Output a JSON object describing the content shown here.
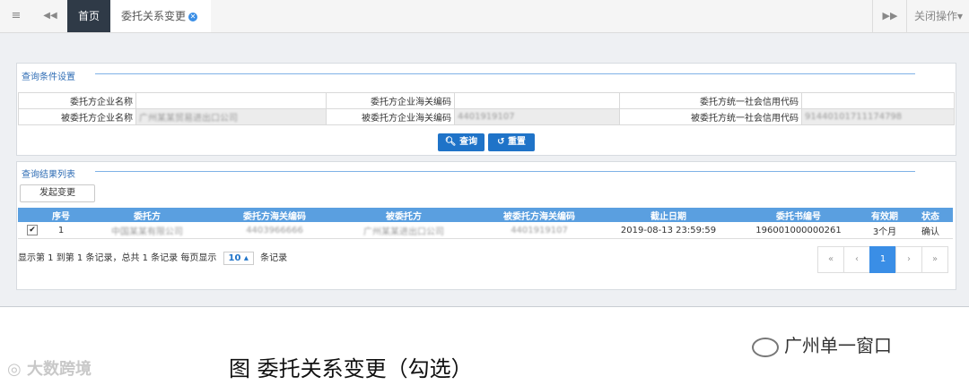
{
  "tabbar": {
    "menu_icon": "≡",
    "prev_icon": "◀◀",
    "home_tab": "首页",
    "active_tab": "委托关系变更",
    "close_glyph": "✕",
    "next_icon": "▶▶",
    "close_ops": "关闭操作▾"
  },
  "query": {
    "section_title": "查询条件设置",
    "rows": [
      [
        {
          "label": "委托方企业名称",
          "value": ""
        },
        {
          "label": "委托方企业海关编码",
          "value": ""
        },
        {
          "label": "委托方统一社会信用代码",
          "value": ""
        }
      ],
      [
        {
          "label": "被委托方企业名称",
          "value": "广州某某贸易进出口公司"
        },
        {
          "label": "被委托方企业海关编码",
          "value": "4401919107"
        },
        {
          "label": "被委托方统一社会信用代码",
          "value": "91440101711174798"
        }
      ]
    ],
    "search_label": "查询",
    "reset_label": "重置"
  },
  "results": {
    "section_title": "查询结果列表",
    "initiate_label": "发起变更",
    "columns": [
      "",
      "序号",
      "委托方",
      "委托方海关编码",
      "被委托方",
      "被委托方海关编码",
      "截止日期",
      "委托书编号",
      "有效期",
      "状态"
    ],
    "rows": [
      [
        "✔",
        "1",
        "中国某某有限公司",
        "4403966666",
        "广州某某进出口公司",
        "4401919107",
        "2019-08-13 23:59:59",
        "196001000000261",
        "3个月",
        "确认"
      ]
    ],
    "pager": {
      "info_prefix": "显示第 1 到第 1 条记录，总共 1 条记录 每页显示",
      "page_size": "10 ▴",
      "info_suffix": "条记录",
      "first": "«",
      "prev": "‹",
      "current": "1",
      "next": "›",
      "last": "»"
    }
  },
  "caption": "图  委托关系变更（勾选）",
  "watermark_left": "大数跨境",
  "watermark_right": "广州单一窗口",
  "colors": {
    "accent": "#1f73c8",
    "header": "#5a9fe0",
    "dark_tab": "#2f3a47"
  }
}
